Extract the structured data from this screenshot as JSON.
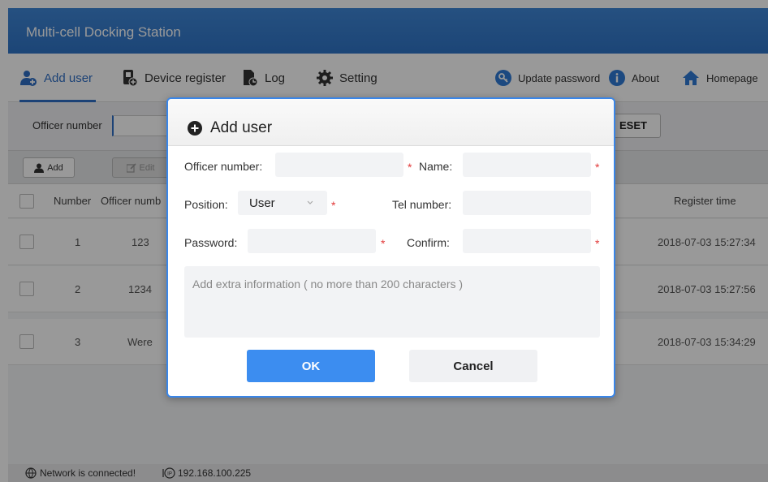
{
  "app": {
    "title": "Multi-cell Docking Station"
  },
  "nav": {
    "items": [
      {
        "label": "Add user",
        "icon": "add-user-icon",
        "active": true
      },
      {
        "label": "Device register",
        "icon": "device-register-icon"
      },
      {
        "label": "Log",
        "icon": "log-icon"
      },
      {
        "label": "Setting",
        "icon": "gear-icon"
      }
    ],
    "right_items": [
      {
        "label": "Update password",
        "icon": "key-icon"
      },
      {
        "label": "About",
        "icon": "info-icon"
      },
      {
        "label": "Homepage",
        "icon": "home-icon"
      }
    ]
  },
  "filter": {
    "officer_label": "Officer number",
    "reset_label": "ESET"
  },
  "toolbar": {
    "add_label": "Add",
    "edit_label": "Edit"
  },
  "table": {
    "headers": {
      "number": "Number",
      "officer": "Officer numb",
      "register_time": "Register time"
    },
    "rows": [
      {
        "number": "1",
        "officer": "123",
        "register_time": "2018-07-03 15:27:34"
      },
      {
        "number": "2",
        "officer": "1234",
        "register_time": "2018-07-03 15:27:56"
      },
      {
        "number": "3",
        "officer": "Were",
        "register_time": "2018-07-03 15:34:29"
      }
    ]
  },
  "status": {
    "network": "Network is connected!",
    "ip": "192.168.100.225"
  },
  "dialog": {
    "title": "Add user",
    "officer_label": "Officer number:",
    "name_label": "Name:",
    "position_label": "Position:",
    "position_value": "User",
    "tel_label": "Tel number:",
    "password_label": "Password:",
    "confirm_label": "Confirm:",
    "required_mark": "*",
    "extra_placeholder": "Add extra information ( no more than 200 characters )",
    "ok_label": "OK",
    "cancel_label": "Cancel"
  },
  "colors": {
    "accent": "#2f6fc5",
    "title_bar": "#3a7fd0",
    "ok_button": "#3c8df0",
    "required": "#e23a3a"
  }
}
